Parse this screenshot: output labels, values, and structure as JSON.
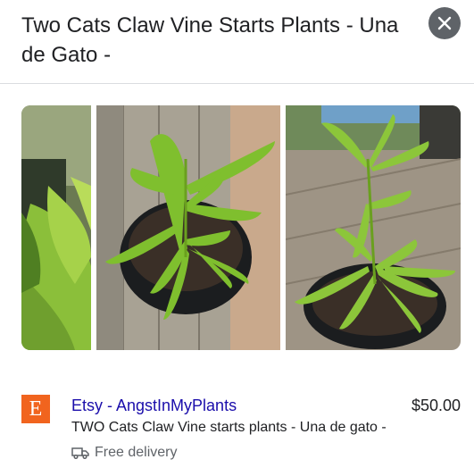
{
  "header": {
    "title": "Two Cats Claw Vine Starts Plants - Una de Gato -",
    "close_icon": "close-icon"
  },
  "gallery": {
    "images": [
      {
        "subject": "plant leaves close-up"
      },
      {
        "subject": "potted plant on wooden deck"
      },
      {
        "subject": "potted plant on wooden deck"
      }
    ]
  },
  "result": {
    "store_logo_letter": "E",
    "store_name": "Etsy - AngstInMyPlants",
    "price": "$50.00",
    "product_title": "TWO Cats Claw Vine starts plants - Una de gato -",
    "delivery": "Free delivery",
    "delivery_icon": "truck-icon",
    "colors": {
      "brand": "#f1641e",
      "link": "#1a0dab"
    }
  }
}
